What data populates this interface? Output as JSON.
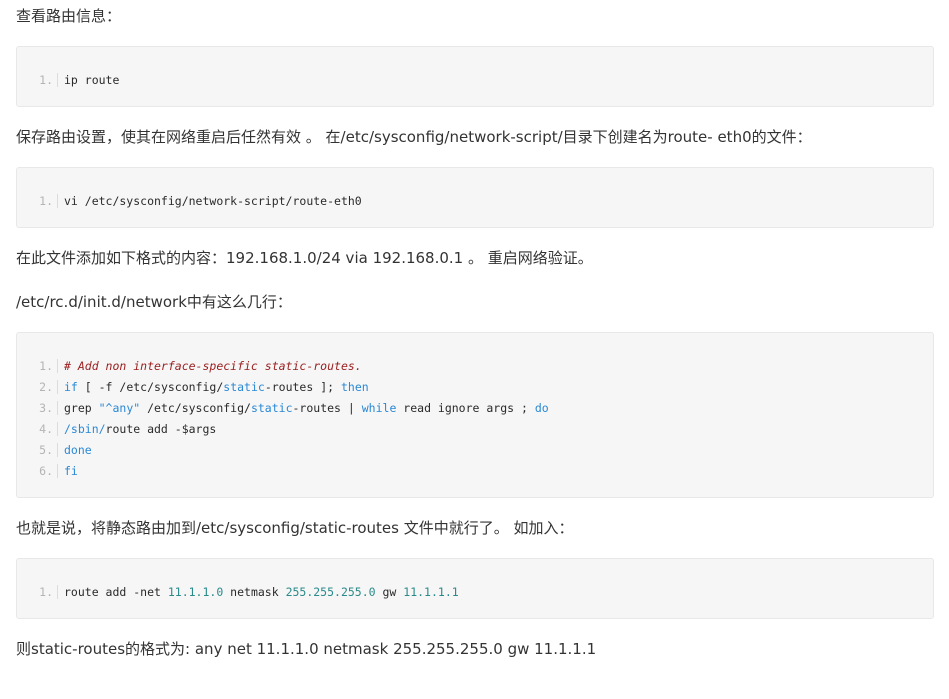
{
  "blocks": [
    {
      "type": "text",
      "text": "查看路由信息："
    },
    {
      "type": "code",
      "lines": [
        [
          [
            "plain",
            "ip route"
          ]
        ]
      ]
    },
    {
      "type": "text",
      "text": "保存路由设置，使其在网络重启后任然有效 。 在/etc/sysconfig/network-script/目录下创建名为route- eth0的文件："
    },
    {
      "type": "code",
      "lines": [
        [
          [
            "plain",
            "vi /etc/sysconfig/network-script/route-eth0"
          ]
        ]
      ]
    },
    {
      "type": "text",
      "text": "在此文件添加如下格式的内容：192.168.1.0/24 via 192.168.0.1 。 重启网络验证。"
    },
    {
      "type": "text",
      "text": "/etc/rc.d/init.d/network中有这么几行："
    },
    {
      "type": "code",
      "lines": [
        [
          [
            "comment",
            "# Add non interface-specific static-routes."
          ]
        ],
        [
          [
            "keyword",
            "if"
          ],
          [
            "plain",
            " [ -f /etc/sysconfig/"
          ],
          [
            "path",
            "static"
          ],
          [
            "plain",
            "-routes ]; "
          ],
          [
            "keyword",
            "then"
          ]
        ],
        [
          [
            "plain",
            "grep "
          ],
          [
            "string",
            "\"^any\""
          ],
          [
            "plain",
            " /etc/sysconfig/"
          ],
          [
            "path",
            "static"
          ],
          [
            "plain",
            "-routes | "
          ],
          [
            "keyword",
            "while"
          ],
          [
            "plain",
            " read ignore args ; "
          ],
          [
            "keyword",
            "do"
          ]
        ],
        [
          [
            "path",
            "/sbin/"
          ],
          [
            "plain",
            "route add -$args"
          ]
        ],
        [
          [
            "keyword",
            "done"
          ]
        ],
        [
          [
            "keyword",
            "fi"
          ]
        ]
      ]
    },
    {
      "type": "text",
      "text": "也就是说，将静态路由加到/etc/sysconfig/static-routes 文件中就行了。 如加入："
    },
    {
      "type": "code",
      "lines": [
        [
          [
            "plain",
            "route add -net "
          ],
          [
            "number",
            "11.1.1.0"
          ],
          [
            "plain",
            " netmask "
          ],
          [
            "number",
            "255.255.255.0"
          ],
          [
            "plain",
            " gw "
          ],
          [
            "number",
            "11.1.1.1"
          ]
        ]
      ]
    },
    {
      "type": "text",
      "text": "则static-routes的格式为: any net 11.1.1.0 netmask 255.255.255.0 gw 11.1.1.1"
    }
  ],
  "colors": {
    "text": "#333333",
    "code_background": "#f6f6f6",
    "code_border": "#e8e8e8",
    "line_number": "#b4b4b4",
    "comment": "#9a1d1d",
    "keyword": "#2a88d4",
    "number": "#2a8a8a"
  }
}
